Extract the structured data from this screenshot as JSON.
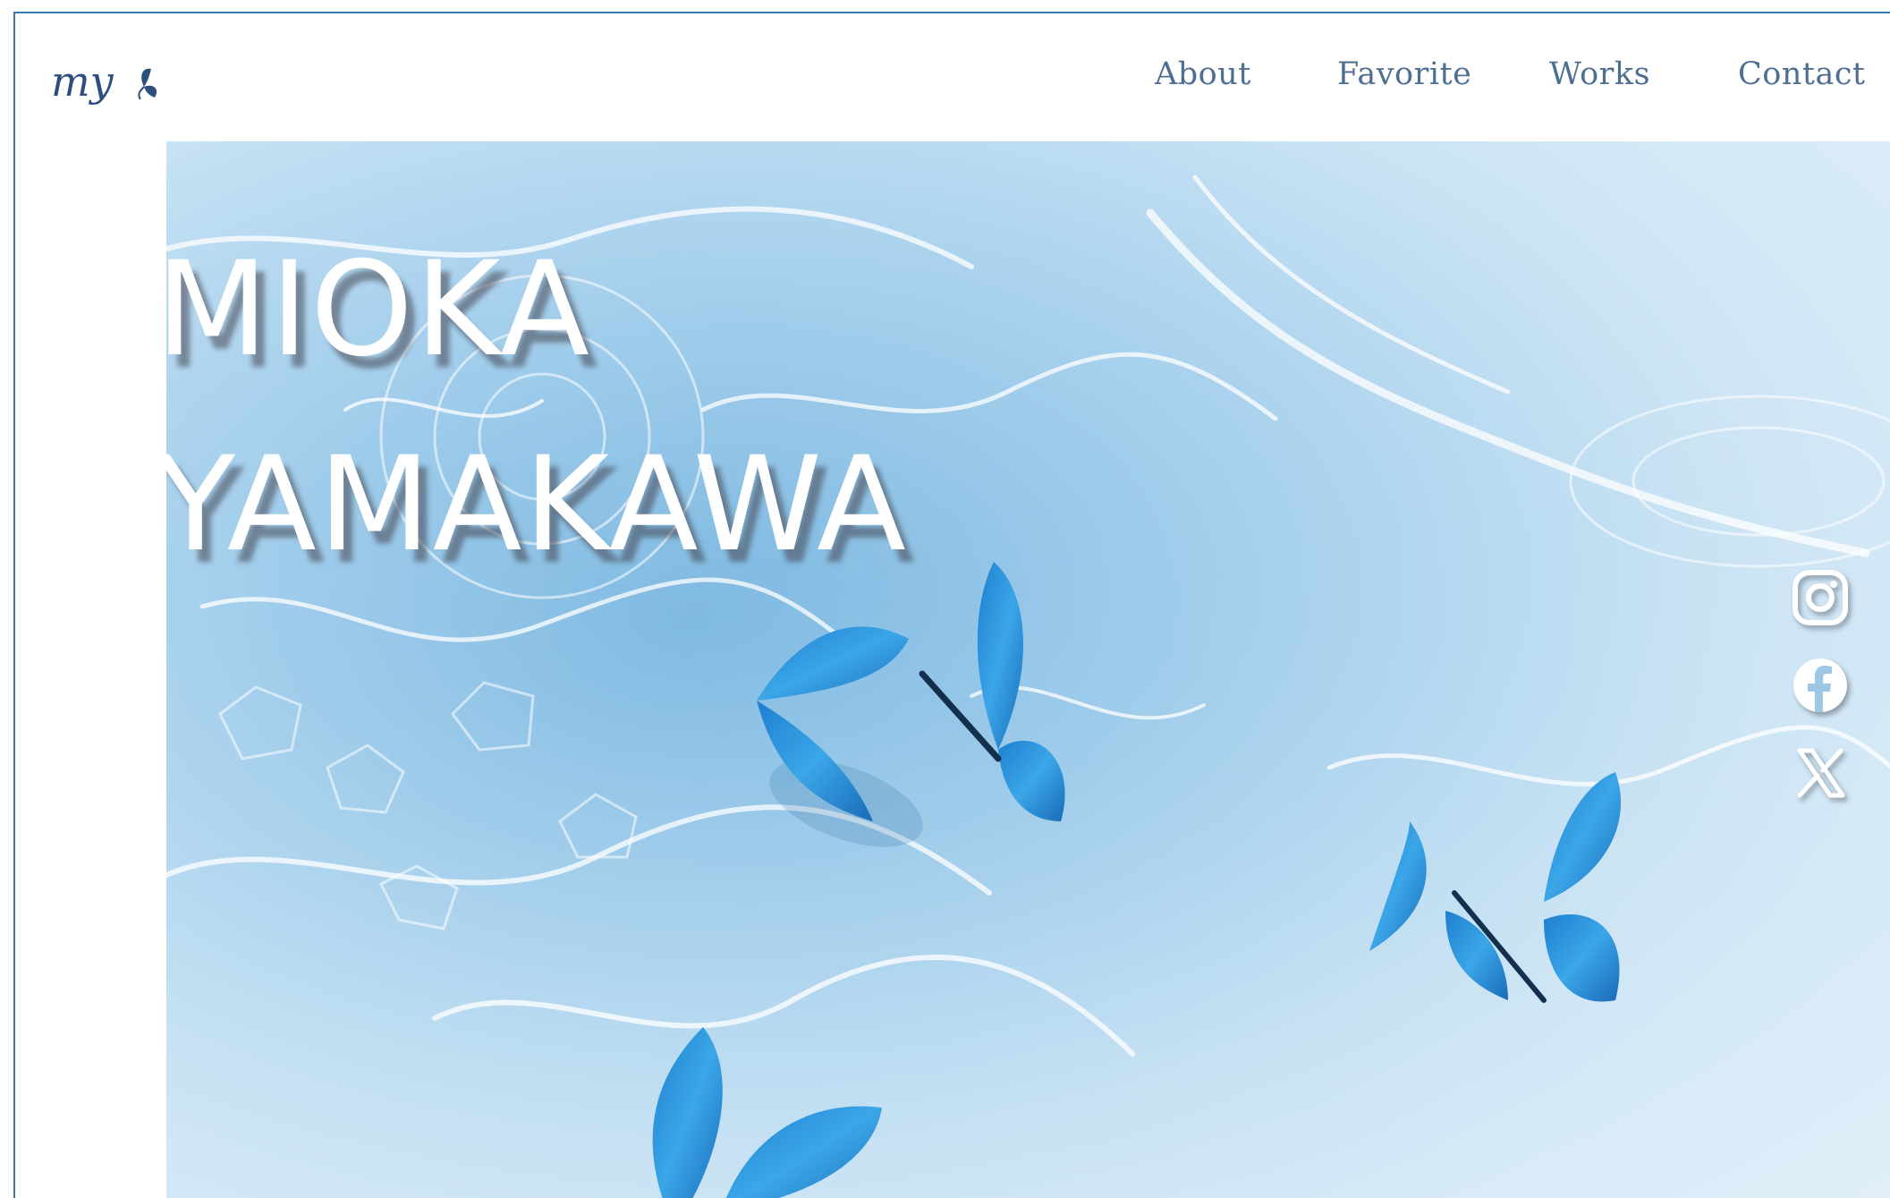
{
  "header": {
    "logo_text": "my",
    "nav": [
      {
        "label": "About"
      },
      {
        "label": "Favorite"
      },
      {
        "label": "Works"
      },
      {
        "label": "Contact"
      }
    ]
  },
  "hero": {
    "name_line1": "MIOKA",
    "name_line2": "YAMAKAWA",
    "image_subject": "blue butterflies on rippling water"
  },
  "social": {
    "icons": [
      "instagram-icon",
      "facebook-icon",
      "x-icon"
    ]
  },
  "colors": {
    "nav_text": "#4e6f92",
    "logo": "#2d4f7d",
    "frame_border": "#3a78b5",
    "butterfly": "#2a8fd6",
    "water": "#a9d2ee"
  }
}
